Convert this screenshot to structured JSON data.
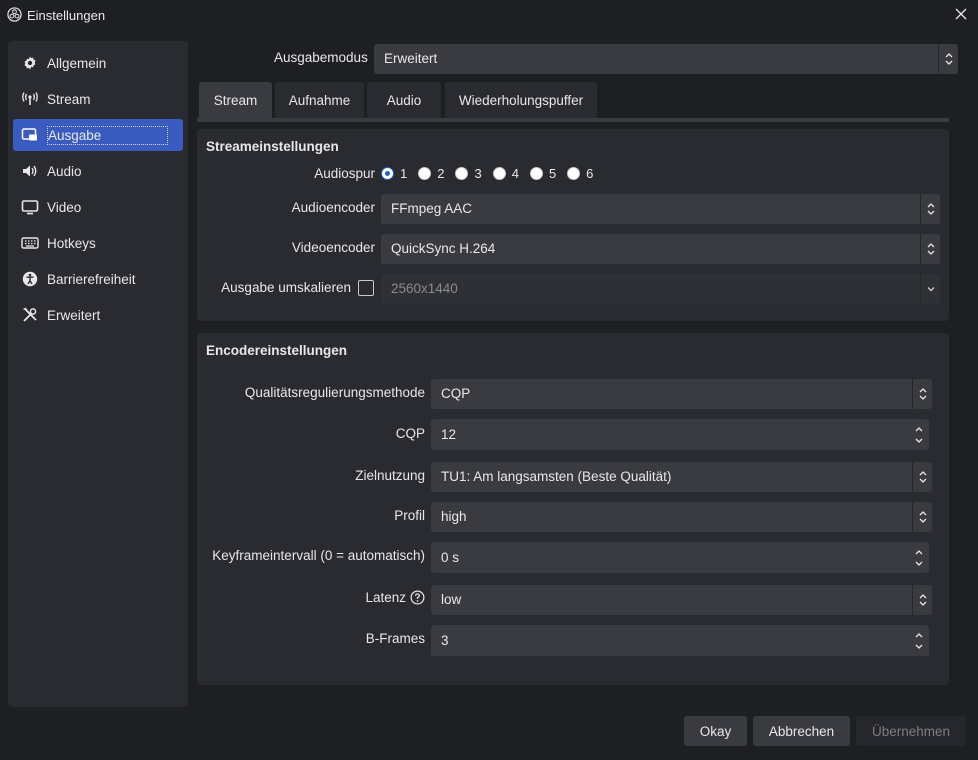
{
  "window": {
    "title": "Einstellungen"
  },
  "sidebar": {
    "items": [
      {
        "label": "Allgemein",
        "icon": "gear-icon"
      },
      {
        "label": "Stream",
        "icon": "antenna-icon"
      },
      {
        "label": "Ausgabe",
        "icon": "output-icon",
        "active": true
      },
      {
        "label": "Audio",
        "icon": "speaker-icon"
      },
      {
        "label": "Video",
        "icon": "monitor-icon"
      },
      {
        "label": "Hotkeys",
        "icon": "keyboard-icon"
      },
      {
        "label": "Barrierefreiheit",
        "icon": "accessibility-icon"
      },
      {
        "label": "Erweitert",
        "icon": "tools-icon"
      }
    ]
  },
  "output_mode": {
    "label": "Ausgabemodus",
    "value": "Erweitert"
  },
  "tabs": [
    {
      "label": "Stream",
      "active": true
    },
    {
      "label": "Aufnahme"
    },
    {
      "label": "Audio"
    },
    {
      "label": "Wiederholungspuffer"
    }
  ],
  "stream_settings": {
    "title": "Streameinstellungen",
    "audio_track": {
      "label": "Audiospur",
      "options": [
        "1",
        "2",
        "3",
        "4",
        "5",
        "6"
      ],
      "selected": "1"
    },
    "audio_encoder": {
      "label": "Audioencoder",
      "value": "FFmpeg AAC"
    },
    "video_encoder": {
      "label": "Videoencoder",
      "value": "QuickSync H.264"
    },
    "rescale": {
      "label": "Ausgabe umskalieren",
      "checked": false,
      "value": "2560x1440"
    }
  },
  "encoder_settings": {
    "title": "Encodereinstellungen",
    "rate_control": {
      "label": "Qualitätsregulierungsmethode",
      "value": "CQP"
    },
    "cqp": {
      "label": "CQP",
      "value": "12"
    },
    "target_usage": {
      "label": "Zielnutzung",
      "value": "TU1: Am langsamsten (Beste Qualität)"
    },
    "profile": {
      "label": "Profil",
      "value": "high"
    },
    "keyframe": {
      "label": "Keyframeintervall (0 = automatisch)",
      "value": "0 s"
    },
    "latency": {
      "label": "Latenz",
      "value": "low"
    },
    "bframes": {
      "label": "B-Frames",
      "value": "3"
    }
  },
  "buttons": {
    "ok": "Okay",
    "cancel": "Abbrechen",
    "apply": "Übernehmen"
  },
  "colors": {
    "accent": "#3a5bbf",
    "background": "#1e1f23",
    "panel": "#2a2b30",
    "field": "#3a3b41"
  }
}
